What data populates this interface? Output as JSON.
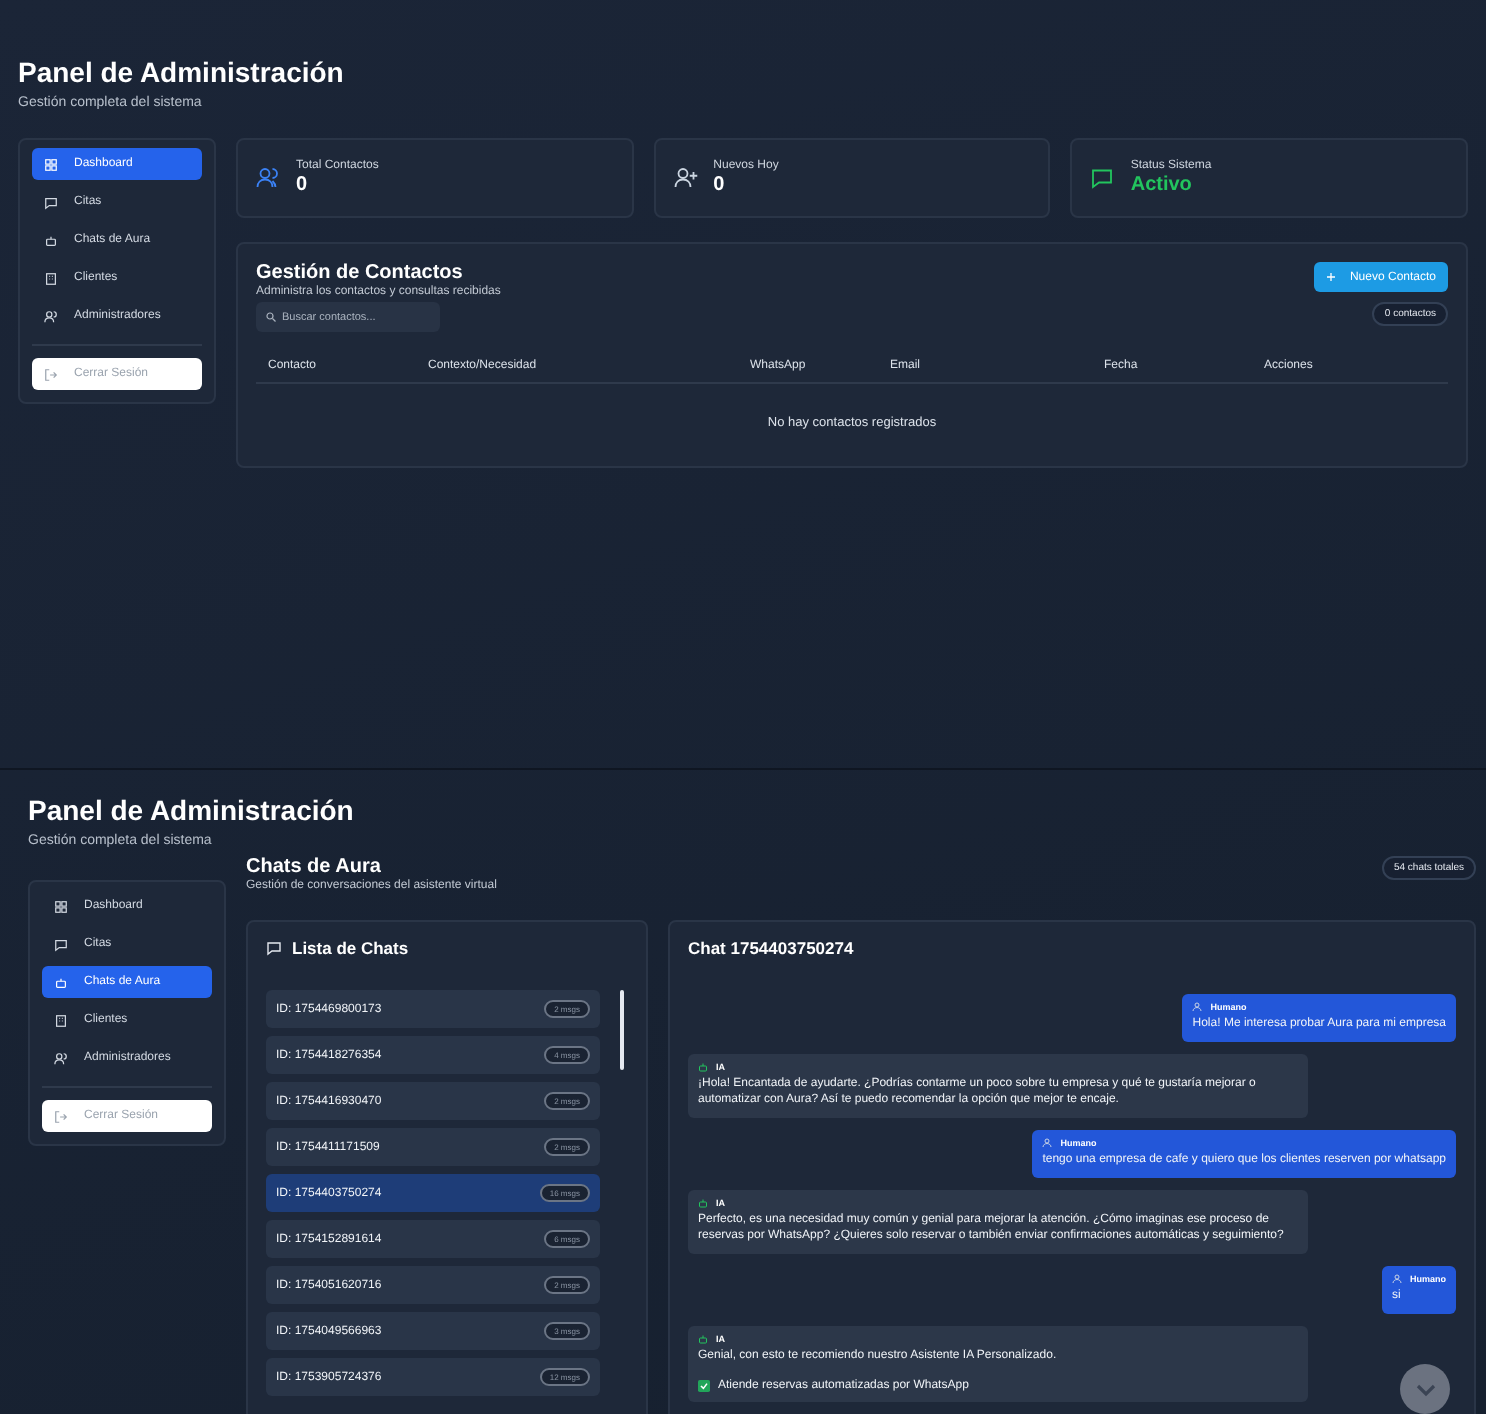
{
  "views": [
    {
      "header": {
        "title": "Panel de Administración",
        "subtitle": "Gestión completa del sistema"
      },
      "sidebar": {
        "items": [
          {
            "label": "Dashboard",
            "selected": true
          },
          {
            "label": "Citas",
            "selected": false
          },
          {
            "label": "Chats de Aura",
            "selected": false
          },
          {
            "label": "Clientes",
            "selected": false
          },
          {
            "label": "Administradores",
            "selected": false
          }
        ],
        "logout": "Cerrar Sesión"
      },
      "kind": "contacts",
      "stats": [
        {
          "label": "Total Contactos",
          "value": "0"
        },
        {
          "label": "Nuevos Hoy",
          "value": "0"
        },
        {
          "label": "Status Sistema",
          "value": "Activo"
        }
      ],
      "contacts": {
        "title": "Gestión de Contactos",
        "subtitle": "Administra los contactos y consultas recibidas",
        "new_button": "Nuevo Contacto",
        "search_placeholder": "Buscar contactos...",
        "count": "0 contactos",
        "columns": [
          "Contacto",
          "Contexto/Necesidad",
          "WhatsApp",
          "Email",
          "Fecha",
          "Acciones"
        ],
        "empty": "No hay contactos registrados"
      }
    },
    {
      "header": {
        "title": "Panel de Administración",
        "subtitle": "Gestión completa del sistema"
      },
      "sidebar": {
        "items": [
          {
            "label": "Dashboard",
            "selected": false
          },
          {
            "label": "Citas",
            "selected": false
          },
          {
            "label": "Chats de Aura",
            "selected": true
          },
          {
            "label": "Clientes",
            "selected": false
          },
          {
            "label": "Administradores",
            "selected": false
          }
        ],
        "logout": "Cerrar Sesión"
      },
      "kind": "chats",
      "chats": {
        "title": "Chats de Aura",
        "subtitle": "Gestión de conversaciones del asistente virtual",
        "total": "54 chats totales",
        "list_title": "Lista de Chats",
        "items": [
          {
            "id": "ID: 1754469800173",
            "count": "2 msgs",
            "selected": false
          },
          {
            "id": "ID: 1754418276354",
            "count": "4 msgs",
            "selected": false
          },
          {
            "id": "ID: 1754416930470",
            "count": "2 msgs",
            "selected": false
          },
          {
            "id": "ID: 1754411171509",
            "count": "2 msgs",
            "selected": false
          },
          {
            "id": "ID: 1754403750274",
            "count": "16 msgs",
            "selected": true
          },
          {
            "id": "ID: 1754152891614",
            "count": "6 msgs",
            "selected": false
          },
          {
            "id": "ID: 1754051620716",
            "count": "2 msgs",
            "selected": false
          },
          {
            "id": "ID: 1754049566963",
            "count": "3 msgs",
            "selected": false
          },
          {
            "id": "ID: 1753905724376",
            "count": "12 msgs",
            "selected": false
          }
        ],
        "chat_title": "Chat 1754403750274",
        "messages": [
          {
            "kind": "human",
            "author": "Humano",
            "text": "Hola! Me interesa probar Aura para mi empresa"
          },
          {
            "kind": "ia",
            "author": "IA",
            "text": "¡Hola! Encantada de ayudarte. ¿Podrías contarme un poco sobre tu empresa y qué te gustaría mejorar o automatizar con Aura? Así te puedo recomendar la opción que mejor te encaje."
          },
          {
            "kind": "human",
            "author": "Humano",
            "text": "tengo una empresa de cafe y quiero que los clientes reserven por whatsapp"
          },
          {
            "kind": "ia",
            "author": "IA",
            "text": "Perfecto, es una necesidad muy común y genial para mejorar la atención. ¿Cómo imaginas ese proceso de reservas por WhatsApp? ¿Quieres solo reservar o también enviar confirmaciones automáticas y seguimiento?"
          },
          {
            "kind": "human",
            "author": "Humano",
            "text": "si"
          },
          {
            "kind": "ia",
            "author": "IA",
            "text": "Genial, con esto te recomiendo nuestro Asistente IA Personalizado.",
            "checklist": [
              "Atiende reservas automatizadas por WhatsApp"
            ]
          }
        ]
      }
    }
  ]
}
